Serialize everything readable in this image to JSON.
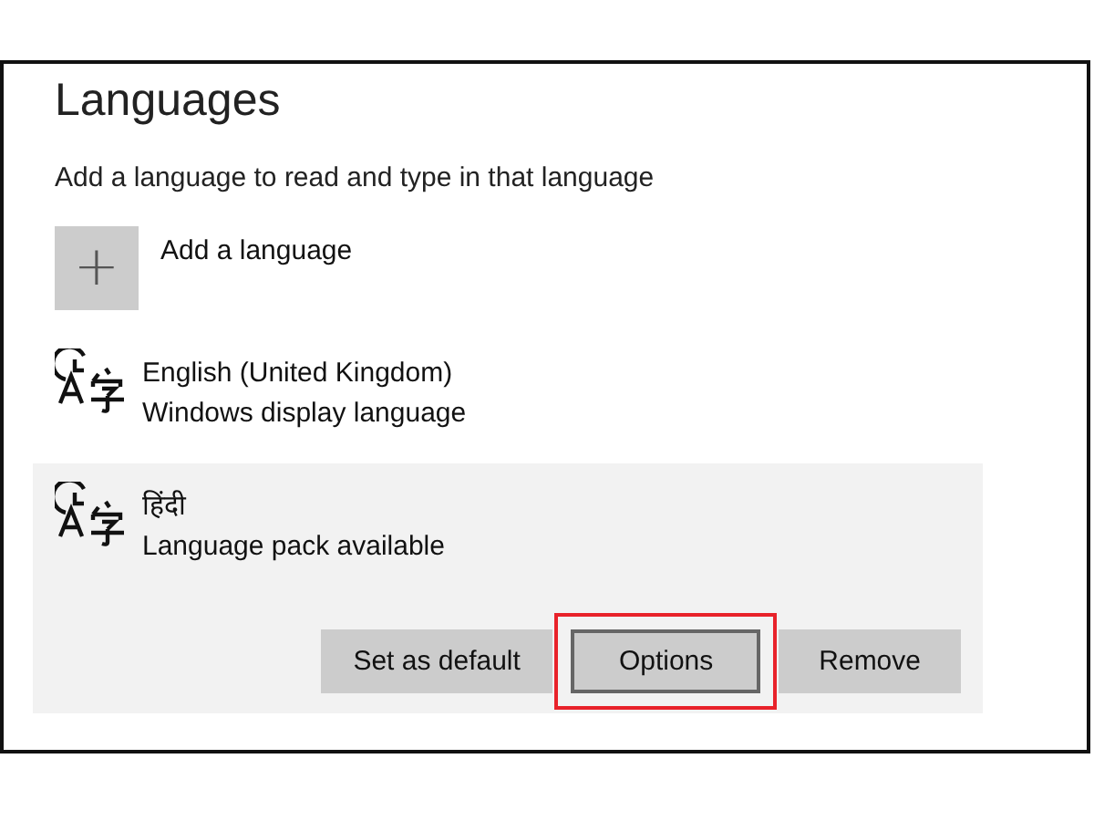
{
  "title": "Languages",
  "description": "Add a language to read and type in that language",
  "add_language": {
    "label": "Add a language",
    "icon": "+"
  },
  "languages": [
    {
      "name": "English (United Kingdom)",
      "status": "Windows display language",
      "selected": false
    },
    {
      "name": "हिंदी",
      "status": "Language pack available",
      "selected": true
    }
  ],
  "actions": [
    {
      "label": "Set as default",
      "focused": false,
      "highlighted": false
    },
    {
      "label": "Options",
      "focused": true,
      "highlighted": true
    },
    {
      "label": "Remove",
      "focused": false,
      "highlighted": false
    }
  ]
}
